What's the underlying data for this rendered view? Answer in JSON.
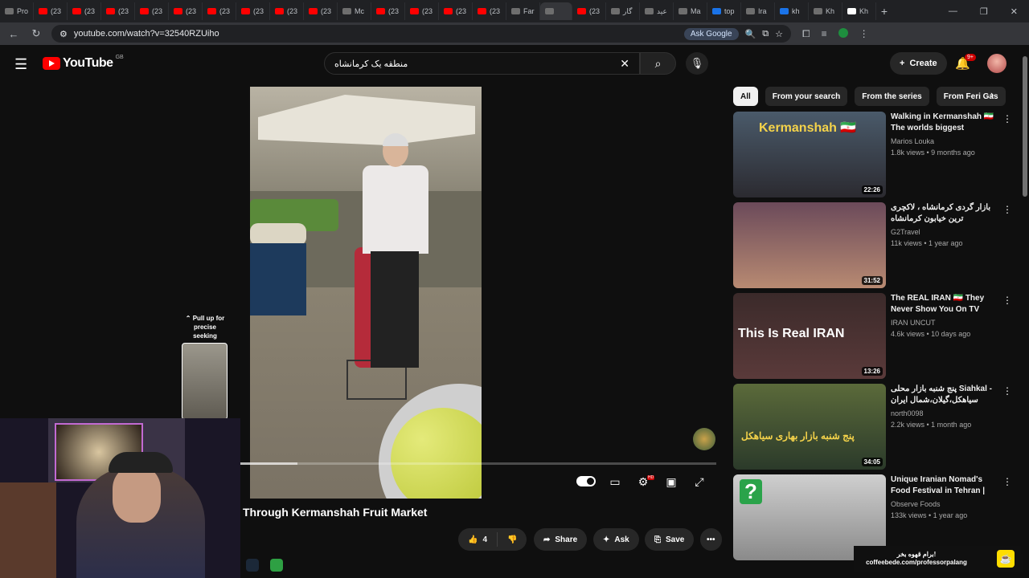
{
  "browser": {
    "tabs": [
      {
        "label": "Pro",
        "icon": "profile-icon"
      },
      {
        "label": "(23",
        "icon": "youtube-icon"
      },
      {
        "label": "(23",
        "icon": "youtube-icon"
      },
      {
        "label": "(23",
        "icon": "youtube-icon"
      },
      {
        "label": "(23",
        "icon": "youtube-icon"
      },
      {
        "label": "(23",
        "icon": "youtube-icon"
      },
      {
        "label": "(23",
        "icon": "youtube-icon"
      },
      {
        "label": "(23",
        "icon": "youtube-icon"
      },
      {
        "label": "(23",
        "icon": "youtube-icon"
      },
      {
        "label": "(23",
        "icon": "youtube-icon"
      },
      {
        "label": "Mc",
        "icon": "mc-icon"
      },
      {
        "label": "(23",
        "icon": "youtube-icon"
      },
      {
        "label": "(23",
        "icon": "youtube-icon"
      },
      {
        "label": "(23",
        "icon": "youtube-icon"
      },
      {
        "label": "(23",
        "icon": "youtube-icon"
      },
      {
        "label": "Far",
        "icon": "doc-icon"
      },
      {
        "label": "",
        "icon": "speaker-icon",
        "active": true
      },
      {
        "label": "(23",
        "icon": "youtube-icon"
      },
      {
        "label": "گار",
        "icon": "site-icon"
      },
      {
        "label": "عید",
        "icon": "site-icon"
      },
      {
        "label": "Ma",
        "icon": "chart-icon"
      },
      {
        "label": "top",
        "icon": "google-icon"
      },
      {
        "label": "Ira",
        "icon": "site-icon"
      },
      {
        "label": "kh",
        "icon": "google-icon"
      },
      {
        "label": "Kh",
        "icon": "site-icon"
      },
      {
        "label": "Kh",
        "icon": "wikipedia-icon"
      }
    ],
    "new_tab": "+",
    "url": "youtube.com/watch?v=32540RZUiho",
    "ask_google": "Ask Google",
    "profile_initial": "a"
  },
  "youtube": {
    "logo_text": "YouTube",
    "country_code": "GB",
    "search_value": "منطقه یک کرمانشاه",
    "create_label": "Create",
    "notifications_badge": "9+"
  },
  "player": {
    "progress_fraction": 0.12,
    "pull_up_text": "Pull up for precise seeking",
    "hd_badge": "HD"
  },
  "video": {
    "title": "Through Kermanshah Fruit Market",
    "like_count": "4",
    "share_label": "Share",
    "ask_label": "Ask",
    "save_label": "Save"
  },
  "chips": [
    {
      "label": "All",
      "active": true
    },
    {
      "label": "From your search"
    },
    {
      "label": "From the series"
    },
    {
      "label": "From Feri Gas"
    }
  ],
  "recommendations": [
    {
      "title": "Walking in Kermanshah 🇮🇷 The worlds biggest Kurdish…",
      "channel": "Marios Louka",
      "meta": "1.8k views • 9 months ago",
      "duration": "22:26",
      "overlay": "Kermanshah 🇮🇷"
    },
    {
      "title": "بازار گردی کرمانشاه ، لاکچری ترین خیابون کرمانشاه",
      "channel": "G2Travel",
      "meta": "11k views • 1 year ago",
      "duration": "31:52",
      "overlay": ""
    },
    {
      "title": "The REAL IRAN 🇮🇷 They Never Show You On TV",
      "channel": "IRAN UNCUT",
      "meta": "4.6k views • 10 days ago",
      "duration": "13:26",
      "overlay": "This Is Real IRAN"
    },
    {
      "title": "پنج شنبه بازار محلی Siahkal - سیاهکل،گیلان،شمال ایران",
      "channel": "north0098",
      "meta": "2.2k views • 1 month ago",
      "duration": "34:05",
      "overlay": "پنج شنبه بازار بهاری سیاهکل"
    },
    {
      "title": "Unique Iranian Nomad's Food Festival in Tehran | Ir…",
      "channel": "Observe Foods",
      "meta": "133k views • 1 year ago",
      "duration": "",
      "overlay": "?"
    }
  ],
  "coffee": {
    "line1": "برام قهوه بخر!",
    "line2": "coffeebede.com/professorpalang"
  }
}
